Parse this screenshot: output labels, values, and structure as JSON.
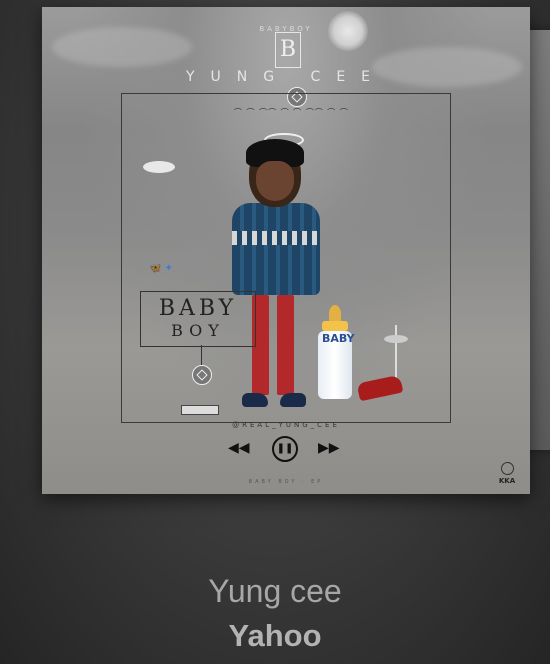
{
  "cover": {
    "label_small": "BABYBOY",
    "monogram": "B",
    "brand": "YUNG CEE",
    "box_line1": "BABY",
    "box_line2": "BOY",
    "bottle_text": "BABY",
    "handle": "@REAL_YUNG_CEE",
    "subtitle": "BABY BOY · EP",
    "corner_logo": "KKA",
    "controls": {
      "prev": "◀◀",
      "play": "❚❚",
      "next": "▶▶"
    }
  },
  "track": {
    "artist": "Yung cee",
    "title": "Yahoo"
  }
}
